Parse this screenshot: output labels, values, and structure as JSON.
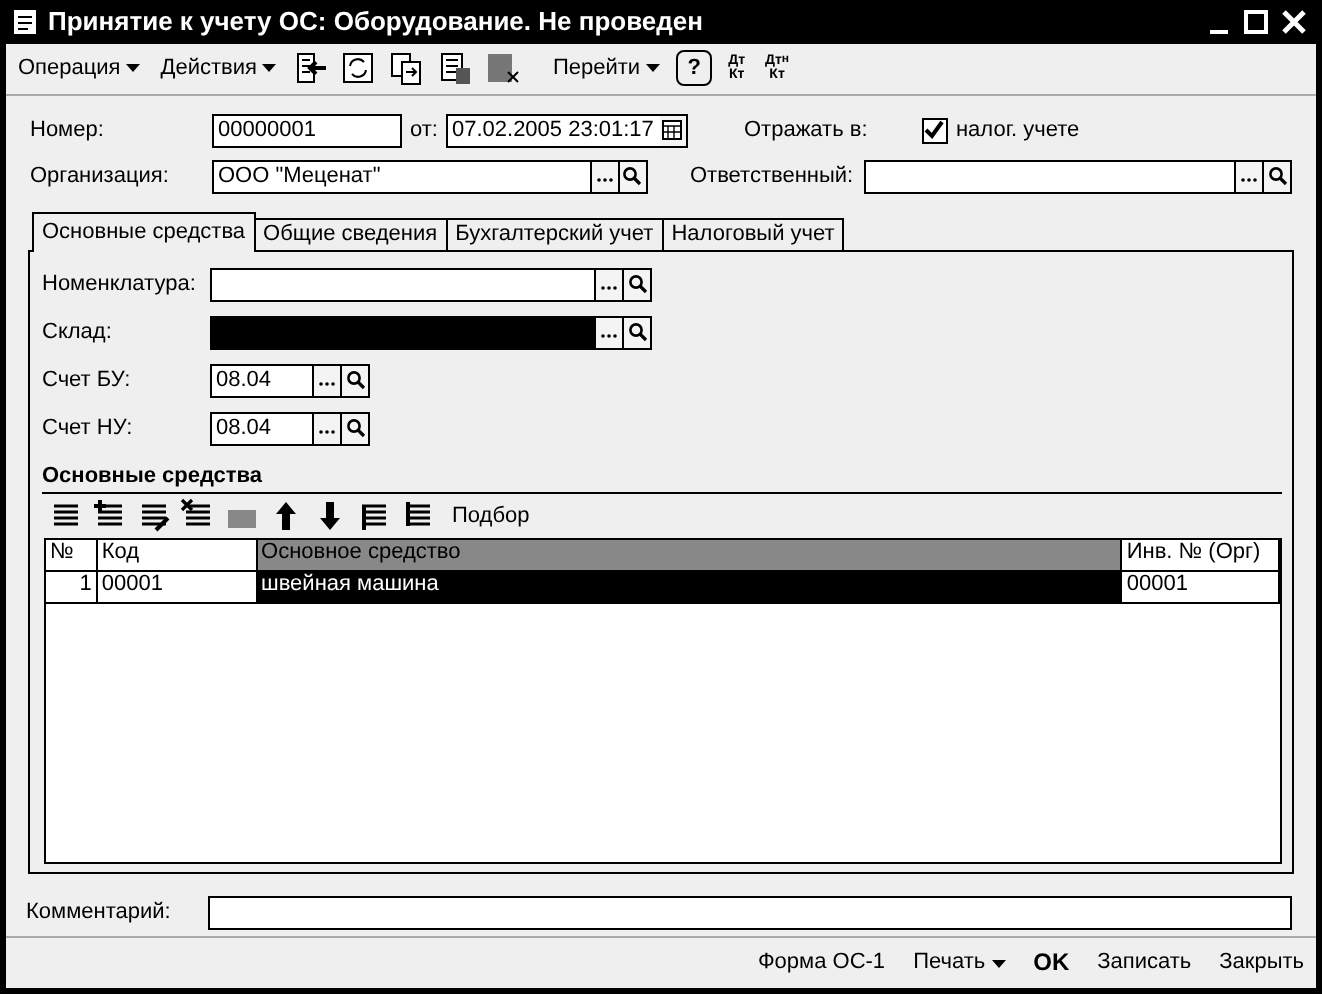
{
  "window": {
    "title": "Принятие к учету ОС: Оборудование. Не проведен"
  },
  "toolbar": {
    "menus": [
      {
        "label": "Операция"
      },
      {
        "label": "Действия"
      }
    ],
    "goto": {
      "label": "Перейти"
    },
    "help": "?",
    "accounting_buttons": [
      {
        "top": "Дт",
        "bottom": "Кт"
      },
      {
        "top": "Дт$^{н}$",
        "bottom": "Кт"
      }
    ]
  },
  "header": {
    "number": {
      "label": "Номер:",
      "value": "00000001"
    },
    "date": {
      "label": "от:",
      "value": "07.02.2005 23:01:17"
    },
    "reflect": {
      "label": "Отражать в:",
      "option": "налог. учете",
      "checked": true
    },
    "organization": {
      "label": "Организация:",
      "value": "ООО \"Меценат\""
    },
    "responsible": {
      "label": "Ответственный:"
    }
  },
  "tabs": [
    {
      "label": "Основные средства",
      "selected": true
    },
    {
      "label": "Общие сведения",
      "selected": false
    },
    {
      "label": "Бухгалтерский учет",
      "selected": false
    },
    {
      "label": "Налоговый учет",
      "selected": false
    }
  ],
  "fields": [
    {
      "label": "Номенклатура:",
      "kind": "wide",
      "highlighted": false
    },
    {
      "label": "Склад:",
      "kind": "wide",
      "highlighted": true
    },
    {
      "label": "Счет БУ:",
      "kind": "short",
      "value": "08.04",
      "highlighted": false
    },
    {
      "label": "Счет НУ:",
      "kind": "short",
      "value": "08.04",
      "highlighted": false
    }
  ],
  "section_title": "Основные средства",
  "table_toolbar": {
    "pick_button": "Подбор"
  },
  "table": {
    "columns": [
      {
        "label": "№",
        "selected": false
      },
      {
        "label": "Код",
        "selected": false
      },
      {
        "label": "Основное средство",
        "selected": true
      },
      {
        "label": "Инв. № (Орг)",
        "selected": false
      }
    ],
    "rows": [
      {
        "cells": [
          {
            "text": "1",
            "selected": false
          },
          {
            "text": "00001",
            "selected": false
          },
          {
            "text": "швейная машина",
            "selected": true
          },
          {
            "text": "00001",
            "selected": false
          }
        ]
      }
    ]
  },
  "comment": {
    "label": "Комментарий:"
  },
  "footer": {
    "buttons": [
      {
        "label": "Форма ОС-1",
        "kind": "plain"
      },
      {
        "label": "Печать",
        "kind": "menu"
      },
      {
        "label": "OK",
        "kind": "default"
      },
      {
        "label": "Записать",
        "kind": "plain"
      },
      {
        "label": "Закрыть",
        "kind": "plain"
      }
    ]
  }
}
